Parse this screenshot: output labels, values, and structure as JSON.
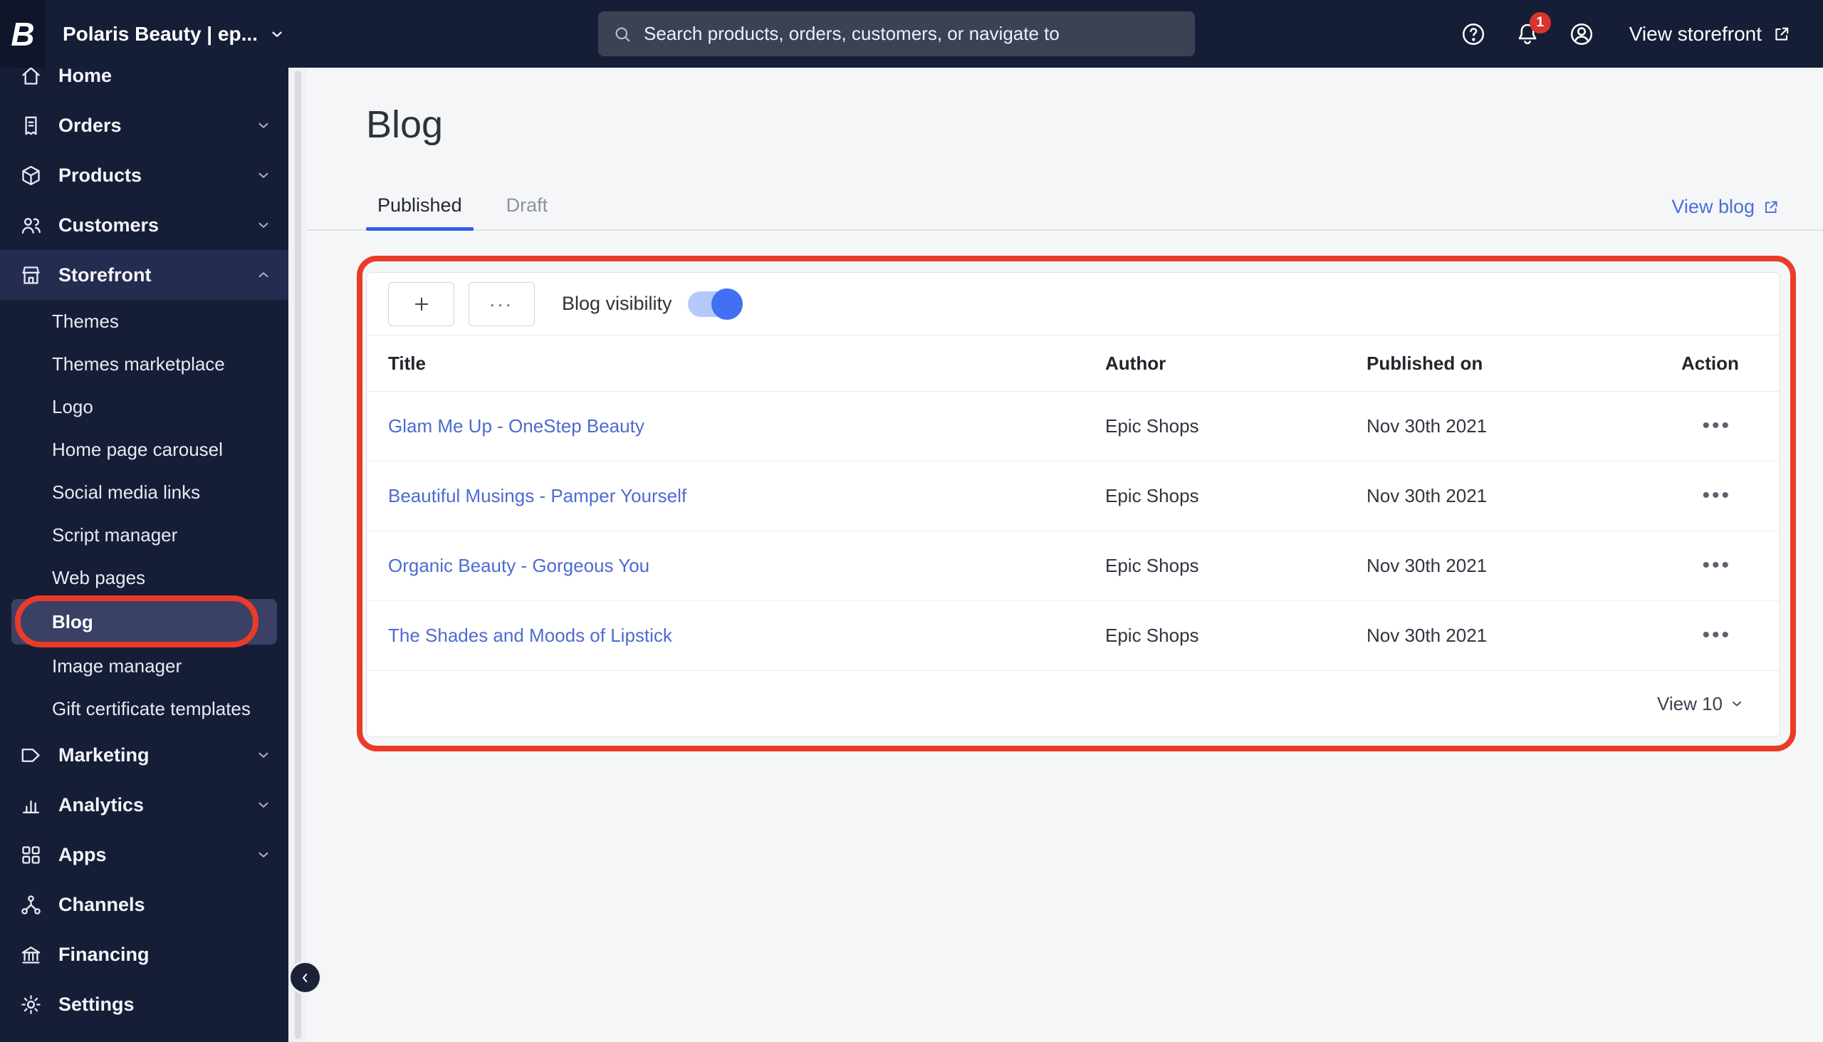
{
  "topbar": {
    "store_name": "Polaris Beauty | ep...",
    "search_placeholder": "Search products, orders, customers, or navigate to",
    "notification_badge": "1",
    "view_storefront": "View storefront"
  },
  "sidebar": {
    "top_items": [
      {
        "label": "Home"
      },
      {
        "label": "Orders"
      },
      {
        "label": "Products"
      },
      {
        "label": "Customers"
      },
      {
        "label": "Storefront"
      }
    ],
    "storefront_subitems": [
      {
        "label": "Themes"
      },
      {
        "label": "Themes marketplace"
      },
      {
        "label": "Logo"
      },
      {
        "label": "Home page carousel"
      },
      {
        "label": "Social media links"
      },
      {
        "label": "Script manager"
      },
      {
        "label": "Web pages"
      },
      {
        "label": "Blog"
      },
      {
        "label": "Image manager"
      },
      {
        "label": "Gift certificate templates"
      }
    ],
    "bottom_items": [
      {
        "label": "Marketing"
      },
      {
        "label": "Analytics"
      },
      {
        "label": "Apps"
      },
      {
        "label": "Channels"
      },
      {
        "label": "Financing"
      },
      {
        "label": "Settings"
      }
    ]
  },
  "main": {
    "page_title": "Blog",
    "tabs": [
      {
        "label": "Published"
      },
      {
        "label": "Draft"
      }
    ],
    "view_blog": "View blog",
    "card": {
      "visibility_label": "Blog visibility",
      "toggle_state": "on"
    },
    "table": {
      "columns": [
        "Title",
        "Author",
        "Published on",
        "Action"
      ],
      "rows": [
        {
          "title": "Glam Me Up - OneStep Beauty",
          "author": "Epic Shops",
          "published": "Nov 30th 2021"
        },
        {
          "title": "Beautiful Musings - Pamper Yourself",
          "author": "Epic Shops",
          "published": "Nov 30th 2021"
        },
        {
          "title": "Organic Beauty - Gorgeous You",
          "author": "Epic Shops",
          "published": "Nov 30th 2021"
        },
        {
          "title": "The Shades and Moods of Lipstick",
          "author": "Epic Shops",
          "published": "Nov 30th 2021"
        }
      ],
      "footer_view": "View 10"
    }
  },
  "colors": {
    "accent_blue": "#2e5bef",
    "navy": "#161d37",
    "annotation_red": "#ea3b28",
    "link_blue": "#4d6bd1",
    "toggle_on": "#4170f2"
  }
}
